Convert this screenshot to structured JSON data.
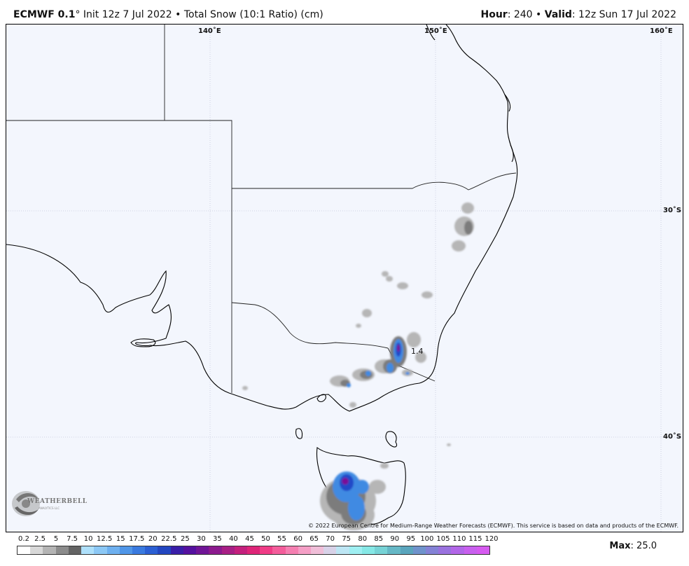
{
  "header": {
    "model": "ECMWF 0.1",
    "degree": "°",
    "init": " Init 12z 7 Jul 2022 • Total Snow (10:1 Ratio) (cm)",
    "hour_label": "Hour",
    "hour_value": ": 240 • ",
    "valid_label": "Valid",
    "valid_value": ": 12z Sun 17 Jul 2022"
  },
  "map": {
    "lon_labels": [
      "140˚E",
      "150˚E",
      "160˚E"
    ],
    "lat_labels": [
      "30˚S",
      "40˚S"
    ],
    "point_label": "1.4",
    "copyright": "© 2022 European Centre for Medium-Range Weather Forecasts (ECMWF). This service is based on data and products of the ECMWF.",
    "logo_text": "WEATHERBELL",
    "logo_sub": "ANALYTICS LLC",
    "colors": {
      "background": "#f3f6fd",
      "coast": "#000000",
      "grid": "#c9cde0"
    }
  },
  "legend": {
    "ticks": [
      "0.2",
      "2.5",
      "5",
      "7.5",
      "10",
      "12.5",
      "15",
      "17.5",
      "20",
      "22.5",
      "25",
      "30",
      "35",
      "40",
      "45",
      "50",
      "55",
      "60",
      "65",
      "70",
      "75",
      "80",
      "85",
      "90",
      "95",
      "100",
      "105",
      "110",
      "115",
      "120"
    ],
    "colors": [
      "#ffffff",
      "#d8d8d8",
      "#b4b4b4",
      "#8c8c8c",
      "#646464",
      "#aee0fb",
      "#8cc8f5",
      "#6eb0ef",
      "#5096e8",
      "#3a7adf",
      "#2b5fd3",
      "#2346c0",
      "#3a1ea8",
      "#55119f",
      "#701596",
      "#8c1a8e",
      "#a81f85",
      "#c4207d",
      "#de2578",
      "#f03c86",
      "#f45d9b",
      "#f57fb1",
      "#f59fc6",
      "#f0bed8",
      "#d8d2e8",
      "#bde6f4",
      "#9feff2",
      "#86e8e6",
      "#77d3d6",
      "#66b8c6",
      "#5aa5bd",
      "#6f93cc",
      "#8482d6",
      "#9a72df",
      "#b266e8",
      "#c860ee",
      "#d65af0"
    ],
    "max_label": "Max",
    "max_value": ": 25.0"
  }
}
